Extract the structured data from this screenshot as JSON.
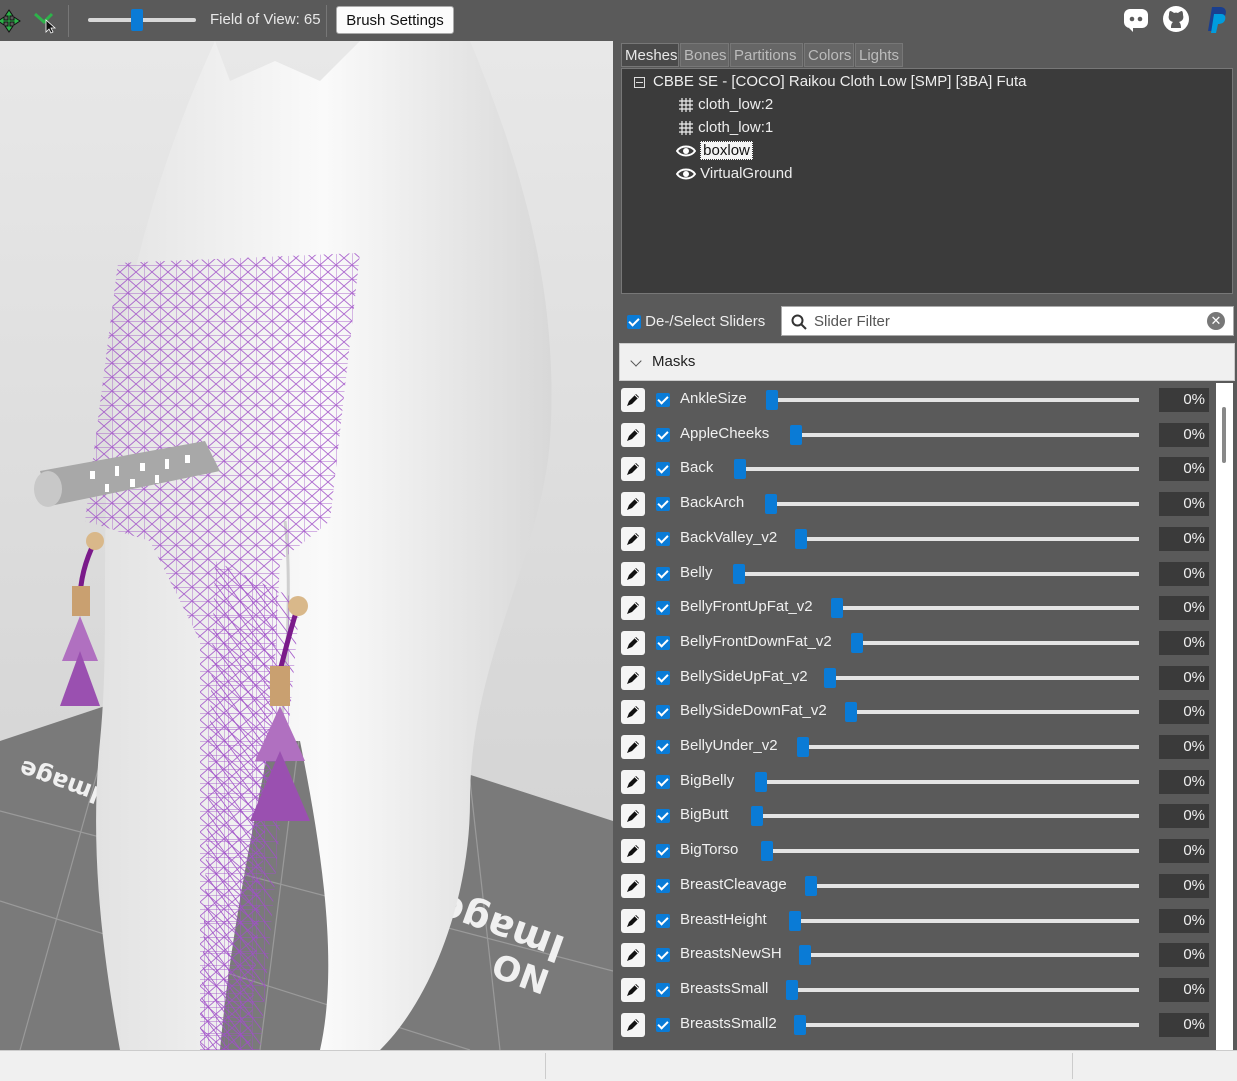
{
  "toolbar": {
    "fov_label": "Field of View: 65",
    "fov_value": 65,
    "brush_settings_label": "Brush Settings",
    "icons": [
      "transform-gizmo-icon",
      "pivot-tool-icon",
      "discord-icon",
      "github-icon",
      "paypal-icon"
    ]
  },
  "viewport": {
    "floor_text": [
      "Image",
      "NO"
    ]
  },
  "tabs": [
    "Meshes",
    "Bones",
    "Partitions",
    "Colors",
    "Lights"
  ],
  "mesh_tree": {
    "root": "CBBE SE - [COCO] Raikou Cloth Low [SMP] [3BA] Futa",
    "children": [
      {
        "label": "cloth_low:2",
        "icon": "mesh-grid-icon",
        "selected": false
      },
      {
        "label": "cloth_low:1",
        "icon": "mesh-grid-icon",
        "selected": false
      },
      {
        "label": "boxlow",
        "icon": "eye-icon",
        "selected": true
      },
      {
        "label": "VirtualGround",
        "icon": "eye-icon",
        "selected": false
      }
    ]
  },
  "slider_panel": {
    "deselect_label": "De-/Select Sliders",
    "filter_placeholder": "Slider Filter",
    "group_label": "Masks"
  },
  "sliders": [
    {
      "name": "AnkleSize",
      "value": "0%"
    },
    {
      "name": "AppleCheeks",
      "value": "0%"
    },
    {
      "name": "Back",
      "value": "0%"
    },
    {
      "name": "BackArch",
      "value": "0%"
    },
    {
      "name": "BackValley_v2",
      "value": "0%"
    },
    {
      "name": "Belly",
      "value": "0%"
    },
    {
      "name": "BellyFrontUpFat_v2",
      "value": "0%"
    },
    {
      "name": "BellyFrontDownFat_v2",
      "value": "0%"
    },
    {
      "name": "BellySideUpFat_v2",
      "value": "0%"
    },
    {
      "name": "BellySideDownFat_v2",
      "value": "0%"
    },
    {
      "name": "BellyUnder_v2",
      "value": "0%"
    },
    {
      "name": "BigBelly",
      "value": "0%"
    },
    {
      "name": "BigButt",
      "value": "0%"
    },
    {
      "name": "BigTorso",
      "value": "0%"
    },
    {
      "name": "BreastCleavage",
      "value": "0%"
    },
    {
      "name": "BreastHeight",
      "value": "0%"
    },
    {
      "name": "BreastsNewSH",
      "value": "0%"
    },
    {
      "name": "BreastsSmall",
      "value": "0%"
    },
    {
      "name": "BreastsSmall2",
      "value": "0%"
    }
  ],
  "colors": {
    "accent": "#0a7bd6",
    "mesh_wire": "#a050c8",
    "panel_bg": "#5a5a5a"
  }
}
